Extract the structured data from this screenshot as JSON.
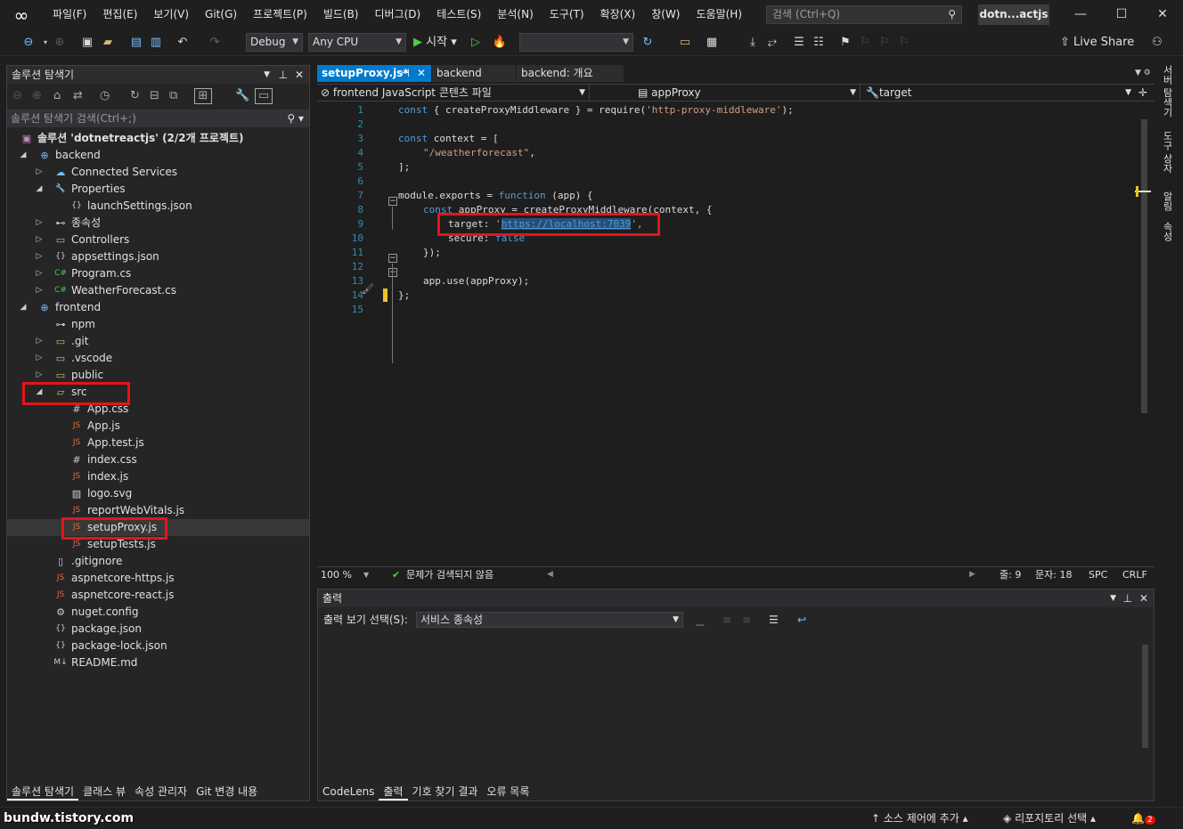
{
  "menubar": {
    "items": [
      "파일(F)",
      "편집(E)",
      "보기(V)",
      "Git(G)",
      "프로젝트(P)",
      "빌드(B)",
      "디버그(D)",
      "테스트(S)",
      "분석(N)",
      "도구(T)",
      "확장(X)",
      "창(W)",
      "도움말(H)"
    ],
    "search_placeholder": "검색 (Ctrl+Q)",
    "solution_title": "dotn...actjs"
  },
  "toolbar": {
    "config": "Debug",
    "platform": "Any CPU",
    "start_label": "시작",
    "live_share": "Live Share"
  },
  "solution_explorer": {
    "title": "솔루션 탐색기",
    "search_placeholder": "솔루션 탐색기 검색(Ctrl+;)",
    "items": [
      {
        "label": "솔루션 'dotnetreactjs' (2/2개 프로젝트)",
        "level": 0,
        "toggle": "",
        "icon": "solution-icon",
        "bold": true
      },
      {
        "label": "backend",
        "level": 1,
        "toggle": "open",
        "icon": "web-project-icon"
      },
      {
        "label": "Connected Services",
        "level": 2,
        "toggle": "closed",
        "icon": "connected-services-icon"
      },
      {
        "label": "Properties",
        "level": 2,
        "toggle": "open",
        "icon": "wrench-icon"
      },
      {
        "label": "launchSettings.json",
        "level": 3,
        "toggle": "",
        "icon": "json-file-icon"
      },
      {
        "label": "종속성",
        "level": 2,
        "toggle": "closed",
        "icon": "dependencies-icon"
      },
      {
        "label": "Controllers",
        "level": 2,
        "toggle": "closed",
        "icon": "folder-icon"
      },
      {
        "label": "appsettings.json",
        "level": 2,
        "toggle": "closed",
        "icon": "json-file-icon"
      },
      {
        "label": "Program.cs",
        "level": 2,
        "toggle": "closed",
        "icon": "csharp-file-icon"
      },
      {
        "label": "WeatherForecast.cs",
        "level": 2,
        "toggle": "closed",
        "icon": "csharp-file-icon"
      },
      {
        "label": "frontend",
        "level": 1,
        "toggle": "open",
        "icon": "web-project-icon"
      },
      {
        "label": "npm",
        "level": 2,
        "toggle": "",
        "icon": "npm-icon"
      },
      {
        "label": ".git",
        "level": 2,
        "toggle": "closed",
        "icon": "folder-icon"
      },
      {
        "label": ".vscode",
        "level": 2,
        "toggle": "closed",
        "icon": "folder-icon"
      },
      {
        "label": "public",
        "level": 2,
        "toggle": "closed",
        "icon": "folder-icon"
      },
      {
        "label": "src",
        "level": 2,
        "toggle": "open",
        "icon": "folder-open-icon"
      },
      {
        "label": "App.css",
        "level": 3,
        "toggle": "",
        "icon": "css-file-icon"
      },
      {
        "label": "App.js",
        "level": 3,
        "toggle": "",
        "icon": "js-file-icon"
      },
      {
        "label": "App.test.js",
        "level": 3,
        "toggle": "",
        "icon": "js-file-icon"
      },
      {
        "label": "index.css",
        "level": 3,
        "toggle": "",
        "icon": "css-file-icon"
      },
      {
        "label": "index.js",
        "level": 3,
        "toggle": "",
        "icon": "js-file-icon"
      },
      {
        "label": "logo.svg",
        "level": 3,
        "toggle": "",
        "icon": "image-file-icon"
      },
      {
        "label": "reportWebVitals.js",
        "level": 3,
        "toggle": "",
        "icon": "js-file-icon"
      },
      {
        "label": "setupProxy.js",
        "level": 3,
        "toggle": "",
        "icon": "js-file-icon",
        "selected": true
      },
      {
        "label": "setupTests.js",
        "level": 3,
        "toggle": "",
        "icon": "js-file-icon"
      },
      {
        "label": ".gitignore",
        "level": 2,
        "toggle": "",
        "icon": "file-icon"
      },
      {
        "label": "aspnetcore-https.js",
        "level": 2,
        "toggle": "",
        "icon": "js-file-icon"
      },
      {
        "label": "aspnetcore-react.js",
        "level": 2,
        "toggle": "",
        "icon": "js-file-icon"
      },
      {
        "label": "nuget.config",
        "level": 2,
        "toggle": "",
        "icon": "config-file-icon"
      },
      {
        "label": "package.json",
        "level": 2,
        "toggle": "",
        "icon": "json-file-icon"
      },
      {
        "label": "package-lock.json",
        "level": 2,
        "toggle": "",
        "icon": "json-file-icon"
      },
      {
        "label": "README.md",
        "level": 2,
        "toggle": "",
        "icon": "markdown-file-icon"
      }
    ],
    "bottom_tabs": [
      "솔루션 탐색기",
      "클래스 뷰",
      "속성 관리자",
      "Git 변경 내용"
    ]
  },
  "editor": {
    "tabs": [
      {
        "label": "setupProxy.js*",
        "active": true
      },
      {
        "label": "backend",
        "active": false
      },
      {
        "label": "backend: 개요",
        "active": false
      }
    ],
    "nav": {
      "project": "frontend JavaScript 콘텐츠 파일",
      "scope": "appProxy",
      "member": "target"
    },
    "line_numbers": [
      "1",
      "2",
      "3",
      "4",
      "5",
      "6",
      "7",
      "8",
      "9",
      "10",
      "11",
      "12",
      "13",
      "14",
      "15"
    ],
    "code": {
      "l1_kw": "const",
      "l1_rest": " { createProxyMiddleware } = require(",
      "l1_str": "'http-proxy-middleware'",
      "l1_end": ");",
      "l3_kw": "const",
      "l3_rest": " context = [",
      "l4_str": "\"/weatherforecast\"",
      "l4_end": ",",
      "l5": "];",
      "l7_rest": "module.exports = ",
      "l7_kw": "function",
      "l7_end": " (app) {",
      "l8_kw": "const",
      "l8_rest": " appProxy = createProxyMiddleware(context, {",
      "l9_key": "target: ",
      "l9_q": "'",
      "l9_url": "https://localhost:7039",
      "l9_end": "',",
      "l10_key": "secure: ",
      "l10_kw": "false",
      "l11": "});",
      "l13": "app.use(appProxy);",
      "l14": "};"
    },
    "status": {
      "zoom": "100 %",
      "issues": "문제가 검색되지 않음",
      "line": "줄: 9",
      "col": "문자: 18",
      "spc": "SPC",
      "crlf": "CRLF"
    }
  },
  "right_rail": [
    "서버 탐색기",
    "도구 상자",
    "알림",
    "속성"
  ],
  "output": {
    "title": "출력",
    "show_label": "출력 보기 선택(S):",
    "selected": "서비스 종속성",
    "bottom_tabs": [
      "CodeLens",
      "출력",
      "기호 찾기 결과",
      "오류 목록"
    ]
  },
  "statusbar": {
    "source_control": "소스 제어에 추가",
    "repo": "리포지토리 선택",
    "notifications": "2",
    "watermark": "bundw.tistory.com"
  },
  "colors": {
    "accent": "#007acc",
    "highlight_box": "#e3151a",
    "selection": "#264f78"
  }
}
